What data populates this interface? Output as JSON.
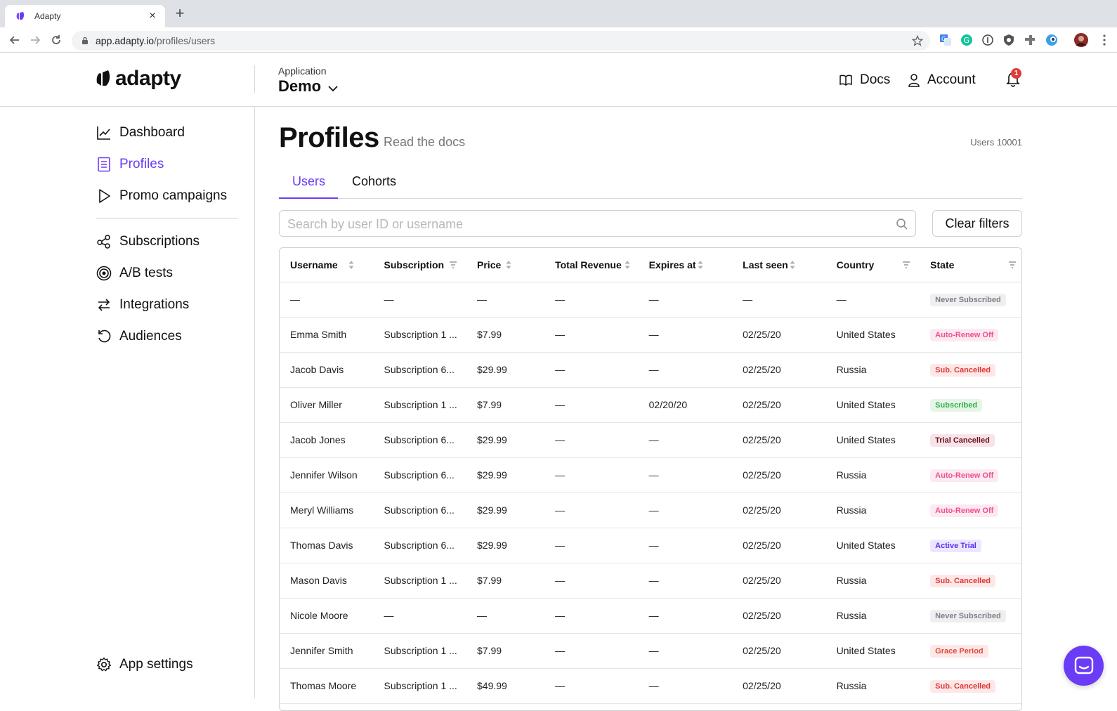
{
  "browser": {
    "tab_title": "Adapty",
    "url_host": "app.adapty.io",
    "url_path": "/profiles/users"
  },
  "header": {
    "logo_text": "adapty",
    "app_label": "Application",
    "app_name": "Demo",
    "docs_label": "Docs",
    "account_label": "Account",
    "notification_count": "1"
  },
  "sidebar": {
    "items": [
      {
        "label": "Dashboard",
        "icon": "chart-line-icon"
      },
      {
        "label": "Profiles",
        "icon": "document-list-icon",
        "active": true
      },
      {
        "label": "Promo campaigns",
        "icon": "play-icon"
      },
      {
        "label": "Subscriptions",
        "icon": "share-nodes-icon"
      },
      {
        "label": "A/B tests",
        "icon": "target-icon"
      },
      {
        "label": "Integrations",
        "icon": "arrows-swap-icon"
      },
      {
        "label": "Audiences",
        "icon": "undo-circle-icon"
      }
    ],
    "settings_label": "App settings"
  },
  "main": {
    "title": "Profiles",
    "docs_link": "Read the docs",
    "users_count": "Users 10001",
    "tabs": [
      {
        "label": "Users",
        "active": true
      },
      {
        "label": "Cohorts",
        "active": false
      }
    ],
    "search": {
      "placeholder": "Search by user ID or username",
      "value": ""
    },
    "clear_filters_label": "Clear filters"
  },
  "table": {
    "columns": [
      "Username",
      "Subscription",
      "Price",
      "Total Revenue",
      "Expires at",
      "Last seen",
      "Country",
      "State"
    ],
    "rows": [
      {
        "username": "—",
        "subscription": "—",
        "price": "—",
        "revenue": "—",
        "expires": "—",
        "last_seen": "—",
        "country": "—",
        "state": "Never Subscribed",
        "state_kind": "never"
      },
      {
        "username": "Emma Smith",
        "subscription": "Subscription 1 ...",
        "price": "$7.99",
        "revenue": "—",
        "expires": "—",
        "last_seen": "02/25/20",
        "country": "United States",
        "state": "Auto-Renew Off",
        "state_kind": "autorenew"
      },
      {
        "username": "Jacob Davis",
        "subscription": "Subscription 6...",
        "price": "$29.99",
        "revenue": "—",
        "expires": "—",
        "last_seen": "02/25/20",
        "country": "Russia",
        "state": "Sub. Cancelled",
        "state_kind": "cancelled"
      },
      {
        "username": "Oliver Miller",
        "subscription": "Subscription 1 ...",
        "price": "$7.99",
        "revenue": "—",
        "expires": "02/20/20",
        "last_seen": "02/25/20",
        "country": "United States",
        "state": "Subscribed",
        "state_kind": "subscribed"
      },
      {
        "username": "Jacob Jones",
        "subscription": "Subscription 6...",
        "price": "$29.99",
        "revenue": "—",
        "expires": "—",
        "last_seen": "02/25/20",
        "country": "United States",
        "state": "Trial Cancelled",
        "state_kind": "trialcancel"
      },
      {
        "username": "Jennifer Wilson",
        "subscription": "Subscription 6...",
        "price": "$29.99",
        "revenue": "—",
        "expires": "—",
        "last_seen": "02/25/20",
        "country": "Russia",
        "state": "Auto-Renew Off",
        "state_kind": "autorenew"
      },
      {
        "username": "Meryl Williams",
        "subscription": "Subscription 6...",
        "price": "$29.99",
        "revenue": "—",
        "expires": "—",
        "last_seen": "02/25/20",
        "country": "Russia",
        "state": "Auto-Renew Off",
        "state_kind": "autorenew"
      },
      {
        "username": "Thomas Davis",
        "subscription": "Subscription 6...",
        "price": "$29.99",
        "revenue": "—",
        "expires": "—",
        "last_seen": "02/25/20",
        "country": "United States",
        "state": "Active Trial",
        "state_kind": "activetrial"
      },
      {
        "username": "Mason Davis",
        "subscription": "Subscription 1 ...",
        "price": "$7.99",
        "revenue": "—",
        "expires": "—",
        "last_seen": "02/25/20",
        "country": "Russia",
        "state": "Sub. Cancelled",
        "state_kind": "cancelled"
      },
      {
        "username": "Nicole Moore",
        "subscription": "—",
        "price": "—",
        "revenue": "—",
        "expires": "—",
        "last_seen": "02/25/20",
        "country": "Russia",
        "state": "Never Subscribed",
        "state_kind": "never"
      },
      {
        "username": "Jennifer Smith",
        "subscription": "Subscription 1 ...",
        "price": "$7.99",
        "revenue": "—",
        "expires": "—",
        "last_seen": "02/25/20",
        "country": "United States",
        "state": "Grace Period",
        "state_kind": "grace"
      },
      {
        "username": "Thomas Moore",
        "subscription": "Subscription 1 ...",
        "price": "$49.99",
        "revenue": "—",
        "expires": "—",
        "last_seen": "02/25/20",
        "country": "Russia",
        "state": "Sub. Cancelled",
        "state_kind": "cancelled"
      }
    ]
  },
  "colors": {
    "accent": "#6b3cf5",
    "border": "#d9d9d9"
  }
}
